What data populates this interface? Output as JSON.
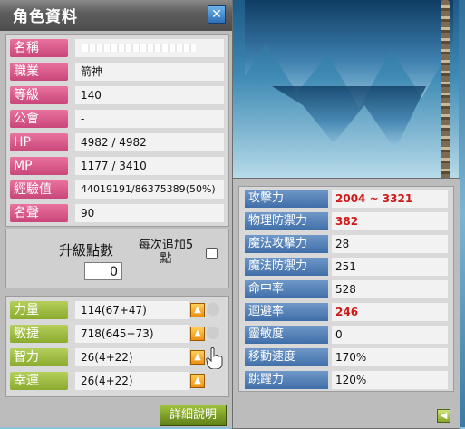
{
  "window": {
    "title": "角色資料",
    "close_icon": "close-icon"
  },
  "profile": {
    "rows": [
      {
        "label": "名稱",
        "value": ""
      },
      {
        "label": "職業",
        "value": "箭神"
      },
      {
        "label": "等級",
        "value": "140"
      },
      {
        "label": "公會",
        "value": "-"
      },
      {
        "label": "HP",
        "value": "4982 / 4982"
      },
      {
        "label": "MP",
        "value": "1177 / 3410"
      },
      {
        "label": "經驗值",
        "value": "44019191/86375389(50%)"
      },
      {
        "label": "名聲",
        "value": "90"
      }
    ]
  },
  "ap": {
    "label": "升級點數",
    "value": "0",
    "auto_label": "每次追加5點"
  },
  "stats": [
    {
      "label": "力量",
      "value": "114(67+47)"
    },
    {
      "label": "敏捷",
      "value": "718(645+73)"
    },
    {
      "label": "智力",
      "value": "26(4+22)"
    },
    {
      "label": "幸運",
      "value": "26(4+22)"
    }
  ],
  "detail_button": "詳細說明",
  "detail": [
    {
      "label": "攻擊力",
      "value": "2004 ~ 3321",
      "highlight": true
    },
    {
      "label": "物理防禦力",
      "value": "382",
      "highlight": true
    },
    {
      "label": "魔法攻擊力",
      "value": "28",
      "highlight": false
    },
    {
      "label": "魔法防禦力",
      "value": "251",
      "highlight": false
    },
    {
      "label": "命中率",
      "value": "528",
      "highlight": false
    },
    {
      "label": "迴避率",
      "value": "246",
      "highlight": true
    },
    {
      "label": "靈敏度",
      "value": "0",
      "highlight": false
    },
    {
      "label": "移動速度",
      "value": "170%",
      "highlight": false
    },
    {
      "label": "跳躍力",
      "value": "120%",
      "highlight": false
    }
  ],
  "colors": {
    "profile_label": "#d9578b",
    "stat_label": "#9fbd45",
    "detail_label": "#5583bb",
    "highlight_value": "#d01818"
  }
}
